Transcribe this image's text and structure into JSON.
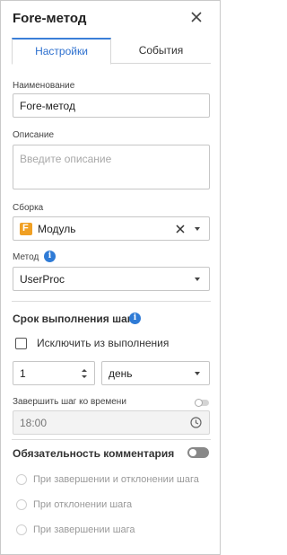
{
  "header": {
    "title": "Fore-метод"
  },
  "tabs": [
    {
      "label": "Настройки",
      "active": true
    },
    {
      "label": "События",
      "active": false
    }
  ],
  "name_field": {
    "label": "Наименование",
    "value": "Fore-метод"
  },
  "description_field": {
    "label": "Описание",
    "placeholder": "Введите описание"
  },
  "assembly_field": {
    "label": "Сборка",
    "icon_letter": "F",
    "value": "Модуль"
  },
  "method_field": {
    "label": "Метод",
    "value": "UserProc"
  },
  "deadline_section": {
    "title": "Срок выполнения шага",
    "exclude_label": "Исключить из выполнения",
    "quantity_value": "1",
    "unit_value": "день",
    "finish_at_label": "Завершить шаг ко времени",
    "time_value": "18:00"
  },
  "comment_section": {
    "title": "Обязательность комментария",
    "options": [
      {
        "label": "При завершении и отклонении шага"
      },
      {
        "label": "При отклонении шага"
      },
      {
        "label": "При завершении шага"
      }
    ]
  },
  "colors": {
    "accent": "#2f7bd6",
    "assembly_icon": "#f0a024"
  }
}
